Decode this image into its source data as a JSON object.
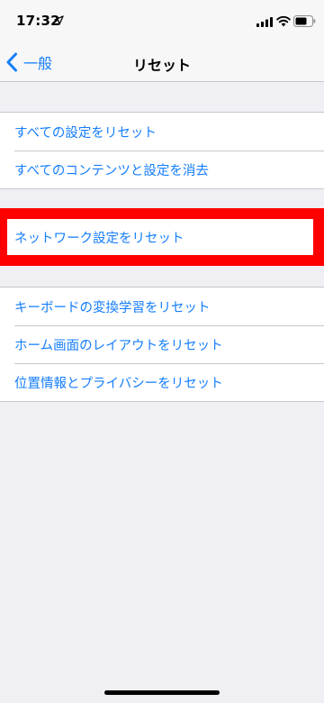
{
  "status_bar": {
    "time": "17:32",
    "icons": [
      "location-arrow",
      "cellular-signal",
      "wifi",
      "battery"
    ]
  },
  "nav": {
    "back_label": "一般",
    "title": "リセット"
  },
  "groups": [
    {
      "items": [
        {
          "label": "すべての設定をリセット"
        },
        {
          "label": "すべてのコンテンツと設定を消去"
        }
      ]
    },
    {
      "highlighted": true,
      "items": [
        {
          "label": "ネットワーク設定をリセット"
        }
      ]
    },
    {
      "items": [
        {
          "label": "キーボードの変換学習をリセット"
        },
        {
          "label": "ホーム画面のレイアウトをリセット"
        },
        {
          "label": "位置情報とプライバシーをリセット"
        }
      ]
    }
  ],
  "colors": {
    "accent": "#157efb",
    "background": "#efeff4",
    "highlight": "#ff0000"
  }
}
